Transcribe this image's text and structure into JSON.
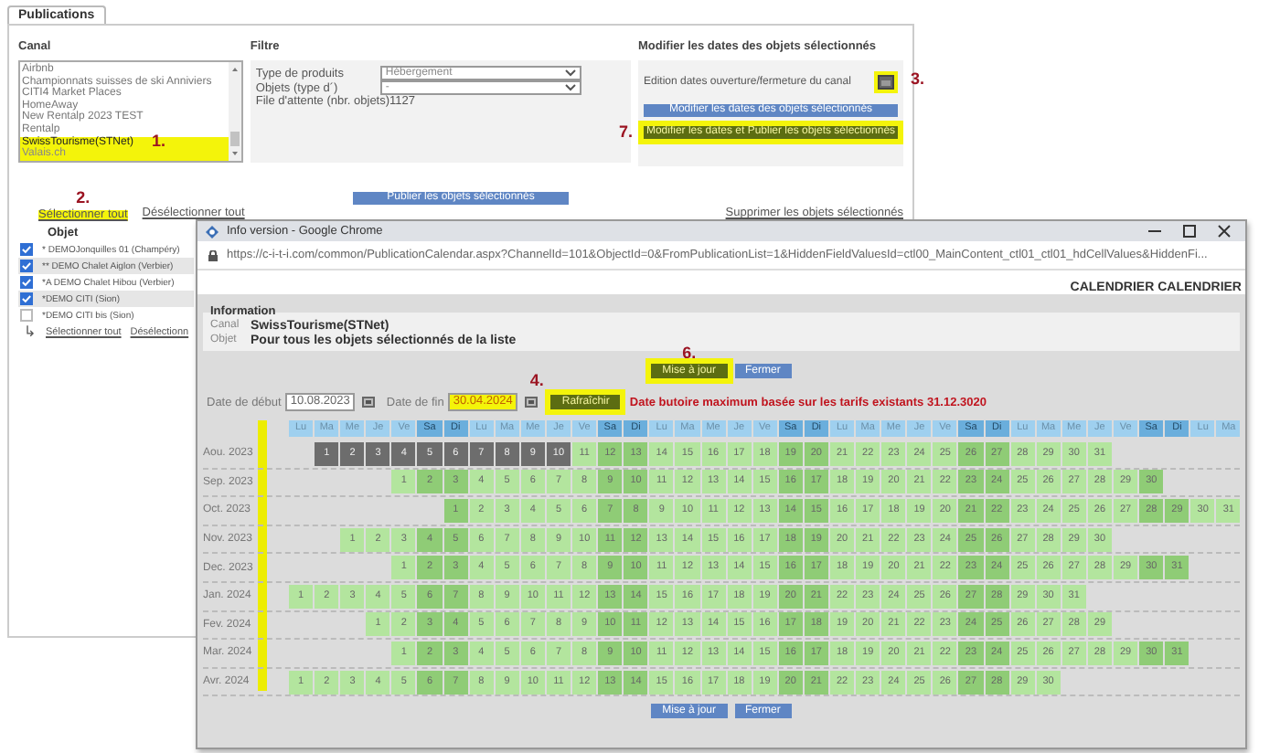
{
  "tabs": [
    {
      "label": "Publications",
      "selected": true
    }
  ],
  "canal": {
    "label": "Canal",
    "items": [
      {
        "label": "Airbnb",
        "selected": false,
        "highlighted": false
      },
      {
        "label": "Championnats suisses de ski Anniviers",
        "selected": false,
        "highlighted": false
      },
      {
        "label": "CITI4 Market Places",
        "selected": false,
        "highlighted": false
      },
      {
        "label": "HomeAway",
        "selected": false,
        "highlighted": false
      },
      {
        "label": "New Rentalp 2023 TEST",
        "selected": false,
        "highlighted": false
      },
      {
        "label": "Rentalp",
        "selected": false,
        "highlighted": false
      },
      {
        "label": "SwissTourisme(STNet)",
        "selected": true,
        "highlighted": true,
        "annotation": "1."
      },
      {
        "label": "Valais.ch",
        "selected": false,
        "highlighted": true
      }
    ]
  },
  "filtre": {
    "label": "Filtre",
    "fields": [
      {
        "label": "Type de produits",
        "value": "Hébergement"
      },
      {
        "label": "Objets (type d´)",
        "value": "-"
      }
    ],
    "queue": "File d'attente (nbr. objets)1127"
  },
  "dates_panel": {
    "title": "Modifier les dates des objets sélectionnés",
    "edit_label": "Edition dates ouverture/fermeture du canal",
    "edit_highlighted": true,
    "edit_annotation": "3.",
    "buttons": [
      {
        "label": "Modifier les dates des objets sélectionnés",
        "highlighted": false
      },
      {
        "label": "Modifier les dates et Publier les objets sélectionnés",
        "highlighted": true,
        "annotation": "7."
      }
    ]
  },
  "publish_button": "Publier les objets sélectionnés",
  "select_links": [
    {
      "label": "Sélectionner tout",
      "highlighted": true,
      "annotation": "2."
    },
    {
      "label": "Désélectionner tout",
      "highlighted": false
    }
  ],
  "delete_link": "Supprimer  les objets sélectionnés",
  "objects": {
    "header": "Objet",
    "rows": [
      {
        "label": "* DEMOJonquilles 01 (Champéry)",
        "checked": true
      },
      {
        "label": "** DEMO Chalet Aiglon (Verbier)",
        "checked": true
      },
      {
        "label": "*A DEMO Chalet Hibou (Verbier)",
        "checked": true
      },
      {
        "label": "*DEMO CITI (Sion)",
        "checked": true
      },
      {
        "label": "*DEMO CITI bis (Sion)",
        "checked": false
      }
    ],
    "sub_arrow": "↳",
    "links": [
      "Sélectionner tout",
      "Désélectionn"
    ]
  },
  "popup": {
    "title": "Info version - Google Chrome",
    "url": "https://c-i-t-i.com/common/PublicationCalendar.aspx?ChannelId=101&ObjectId=0&FromPublicationList=1&HiddenFieldValuesId=ctl00_MainContent_ctl01_ctl01_hdCellValues&HiddenFi...",
    "heading": "CALENDRIER CALENDRIER",
    "info": {
      "title": "Information",
      "rows": [
        {
          "label": "Canal",
          "value": "SwissTourisme(STNet)"
        },
        {
          "label": "Objet",
          "value": "Pour tous les objets sélectionnés de la liste"
        }
      ]
    },
    "top_buttons": [
      {
        "label": "Mise à jour",
        "highlighted": true,
        "annotation": "6."
      },
      {
        "label": "Fermer",
        "highlighted": false
      }
    ],
    "start": {
      "label": "Date de début",
      "value": "10.08.2023",
      "highlighted": false
    },
    "end": {
      "label": "Date de fin",
      "value": "30.04.2024",
      "highlighted": true,
      "annotation": "4."
    },
    "refresh": {
      "label": "Rafraîchir",
      "highlighted": true
    },
    "notice": "Date butoire maximum basée sur les tarifs existants  31.12.3020",
    "month_column_highlighted": true,
    "weekdays": [
      {
        "label": "Lu",
        "weekend": false
      },
      {
        "label": "Ma",
        "weekend": false
      },
      {
        "label": "Me",
        "weekend": false
      },
      {
        "label": "Je",
        "weekend": false
      },
      {
        "label": "Ve",
        "weekend": false
      },
      {
        "label": "Sa",
        "weekend": true
      },
      {
        "label": "Di",
        "weekend": true
      },
      {
        "label": "Lu",
        "weekend": false
      },
      {
        "label": "Ma",
        "weekend": false
      },
      {
        "label": "Me",
        "weekend": false
      },
      {
        "label": "Je",
        "weekend": false
      },
      {
        "label": "Ve",
        "weekend": false
      },
      {
        "label": "Sa",
        "weekend": true
      },
      {
        "label": "Di",
        "weekend": true
      },
      {
        "label": "Lu",
        "weekend": false
      },
      {
        "label": "Ma",
        "weekend": false
      },
      {
        "label": "Me",
        "weekend": false
      },
      {
        "label": "Je",
        "weekend": false
      },
      {
        "label": "Ve",
        "weekend": false
      },
      {
        "label": "Sa",
        "weekend": true
      },
      {
        "label": "Di",
        "weekend": true
      },
      {
        "label": "Lu",
        "weekend": false
      },
      {
        "label": "Ma",
        "weekend": false
      },
      {
        "label": "Me",
        "weekend": false
      },
      {
        "label": "Je",
        "weekend": false
      },
      {
        "label": "Ve",
        "weekend": false
      },
      {
        "label": "Sa",
        "weekend": true
      },
      {
        "label": "Di",
        "weekend": true
      },
      {
        "label": "Lu",
        "weekend": false
      },
      {
        "label": "Ma",
        "weekend": false
      },
      {
        "label": "Me",
        "weekend": false
      },
      {
        "label": "Je",
        "weekend": false
      },
      {
        "label": "Ve",
        "weekend": false
      },
      {
        "label": "Sa",
        "weekend": true
      },
      {
        "label": "Di",
        "weekend": true
      },
      {
        "label": "Lu",
        "weekend": false
      },
      {
        "label": "Ma",
        "weekend": false
      }
    ],
    "months": [
      {
        "label": "Aou. 2023",
        "days": [
          {
            "kind": "blank"
          },
          {
            "kind": "day",
            "d": "1",
            "closed": true
          },
          {
            "kind": "day",
            "d": "2",
            "closed": true
          },
          {
            "kind": "day",
            "d": "3",
            "closed": true
          },
          {
            "kind": "day",
            "d": "4",
            "closed": true
          },
          {
            "kind": "day",
            "d": "5",
            "closed": true
          },
          {
            "kind": "day",
            "d": "6",
            "closed": true
          },
          {
            "kind": "day",
            "d": "7",
            "closed": true
          },
          {
            "kind": "day",
            "d": "8",
            "closed": true
          },
          {
            "kind": "day",
            "d": "9",
            "closed": true
          },
          {
            "kind": "day",
            "d": "10",
            "closed": true
          },
          {
            "kind": "day",
            "d": "11",
            "closed": false
          },
          {
            "kind": "day",
            "d": "12",
            "closed": false
          },
          {
            "kind": "day",
            "d": "13",
            "closed": false
          },
          {
            "kind": "day",
            "d": "14",
            "closed": false
          },
          {
            "kind": "day",
            "d": "15",
            "closed": false
          },
          {
            "kind": "day",
            "d": "16",
            "closed": false
          },
          {
            "kind": "day",
            "d": "17",
            "closed": false
          },
          {
            "kind": "day",
            "d": "18",
            "closed": false
          },
          {
            "kind": "day",
            "d": "19",
            "closed": false
          },
          {
            "kind": "day",
            "d": "20",
            "closed": false
          },
          {
            "kind": "day",
            "d": "21",
            "closed": false
          },
          {
            "kind": "day",
            "d": "22",
            "closed": false
          },
          {
            "kind": "day",
            "d": "23",
            "closed": false
          },
          {
            "kind": "day",
            "d": "24",
            "closed": false
          },
          {
            "kind": "day",
            "d": "25",
            "closed": false
          },
          {
            "kind": "day",
            "d": "26",
            "closed": false
          },
          {
            "kind": "day",
            "d": "27",
            "closed": false
          },
          {
            "kind": "day",
            "d": "28",
            "closed": false
          },
          {
            "kind": "day",
            "d": "29",
            "closed": false
          },
          {
            "kind": "day",
            "d": "30",
            "closed": false
          },
          {
            "kind": "day",
            "d": "31",
            "closed": false
          }
        ]
      },
      {
        "label": "Sep. 2023",
        "days": [
          {
            "kind": "blank"
          },
          {
            "kind": "blank"
          },
          {
            "kind": "blank"
          },
          {
            "kind": "blank"
          },
          {
            "kind": "day",
            "d": "1",
            "closed": false
          },
          {
            "kind": "day",
            "d": "2",
            "closed": false
          },
          {
            "kind": "day",
            "d": "3",
            "closed": false
          },
          {
            "kind": "day",
            "d": "4",
            "closed": false
          },
          {
            "kind": "day",
            "d": "5",
            "closed": false
          },
          {
            "kind": "day",
            "d": "6",
            "closed": false
          },
          {
            "kind": "day",
            "d": "7",
            "closed": false
          },
          {
            "kind": "day",
            "d": "8",
            "closed": false
          },
          {
            "kind": "day",
            "d": "9",
            "closed": false
          },
          {
            "kind": "day",
            "d": "10",
            "closed": false
          },
          {
            "kind": "day",
            "d": "11",
            "closed": false
          },
          {
            "kind": "day",
            "d": "12",
            "closed": false
          },
          {
            "kind": "day",
            "d": "13",
            "closed": false
          },
          {
            "kind": "day",
            "d": "14",
            "closed": false
          },
          {
            "kind": "day",
            "d": "15",
            "closed": false
          },
          {
            "kind": "day",
            "d": "16",
            "closed": false
          },
          {
            "kind": "day",
            "d": "17",
            "closed": false
          },
          {
            "kind": "day",
            "d": "18",
            "closed": false
          },
          {
            "kind": "day",
            "d": "19",
            "closed": false
          },
          {
            "kind": "day",
            "d": "20",
            "closed": false
          },
          {
            "kind": "day",
            "d": "21",
            "closed": false
          },
          {
            "kind": "day",
            "d": "22",
            "closed": false
          },
          {
            "kind": "day",
            "d": "23",
            "closed": false
          },
          {
            "kind": "day",
            "d": "24",
            "closed": false
          },
          {
            "kind": "day",
            "d": "25",
            "closed": false
          },
          {
            "kind": "day",
            "d": "26",
            "closed": false
          },
          {
            "kind": "day",
            "d": "27",
            "closed": false
          },
          {
            "kind": "day",
            "d": "28",
            "closed": false
          },
          {
            "kind": "day",
            "d": "29",
            "closed": false
          },
          {
            "kind": "day",
            "d": "30",
            "closed": false
          }
        ]
      },
      {
        "label": "Oct. 2023",
        "days": [
          {
            "kind": "blank"
          },
          {
            "kind": "blank"
          },
          {
            "kind": "blank"
          },
          {
            "kind": "blank"
          },
          {
            "kind": "blank"
          },
          {
            "kind": "blank"
          },
          {
            "kind": "day",
            "d": "1",
            "closed": false
          },
          {
            "kind": "day",
            "d": "2",
            "closed": false
          },
          {
            "kind": "day",
            "d": "3",
            "closed": false
          },
          {
            "kind": "day",
            "d": "4",
            "closed": false
          },
          {
            "kind": "day",
            "d": "5",
            "closed": false
          },
          {
            "kind": "day",
            "d": "6",
            "closed": false
          },
          {
            "kind": "day",
            "d": "7",
            "closed": false
          },
          {
            "kind": "day",
            "d": "8",
            "closed": false
          },
          {
            "kind": "day",
            "d": "9",
            "closed": false
          },
          {
            "kind": "day",
            "d": "10",
            "closed": false
          },
          {
            "kind": "day",
            "d": "11",
            "closed": false
          },
          {
            "kind": "day",
            "d": "12",
            "closed": false
          },
          {
            "kind": "day",
            "d": "13",
            "closed": false
          },
          {
            "kind": "day",
            "d": "14",
            "closed": false
          },
          {
            "kind": "day",
            "d": "15",
            "closed": false
          },
          {
            "kind": "day",
            "d": "16",
            "closed": false
          },
          {
            "kind": "day",
            "d": "17",
            "closed": false
          },
          {
            "kind": "day",
            "d": "18",
            "closed": false
          },
          {
            "kind": "day",
            "d": "19",
            "closed": false
          },
          {
            "kind": "day",
            "d": "20",
            "closed": false
          },
          {
            "kind": "day",
            "d": "21",
            "closed": false
          },
          {
            "kind": "day",
            "d": "22",
            "closed": false
          },
          {
            "kind": "day",
            "d": "23",
            "closed": false
          },
          {
            "kind": "day",
            "d": "24",
            "closed": false
          },
          {
            "kind": "day",
            "d": "25",
            "closed": false
          },
          {
            "kind": "day",
            "d": "26",
            "closed": false
          },
          {
            "kind": "day",
            "d": "27",
            "closed": false
          },
          {
            "kind": "day",
            "d": "28",
            "closed": false
          },
          {
            "kind": "day",
            "d": "29",
            "closed": false
          },
          {
            "kind": "day",
            "d": "30",
            "closed": false
          },
          {
            "kind": "day",
            "d": "31",
            "closed": false
          }
        ]
      },
      {
        "label": "Nov. 2023",
        "days": [
          {
            "kind": "blank"
          },
          {
            "kind": "blank"
          },
          {
            "kind": "day",
            "d": "1",
            "closed": false
          },
          {
            "kind": "day",
            "d": "2",
            "closed": false
          },
          {
            "kind": "day",
            "d": "3",
            "closed": false
          },
          {
            "kind": "day",
            "d": "4",
            "closed": false
          },
          {
            "kind": "day",
            "d": "5",
            "closed": false
          },
          {
            "kind": "day",
            "d": "6",
            "closed": false
          },
          {
            "kind": "day",
            "d": "7",
            "closed": false
          },
          {
            "kind": "day",
            "d": "8",
            "closed": false
          },
          {
            "kind": "day",
            "d": "9",
            "closed": false
          },
          {
            "kind": "day",
            "d": "10",
            "closed": false
          },
          {
            "kind": "day",
            "d": "11",
            "closed": false
          },
          {
            "kind": "day",
            "d": "12",
            "closed": false
          },
          {
            "kind": "day",
            "d": "13",
            "closed": false
          },
          {
            "kind": "day",
            "d": "14",
            "closed": false
          },
          {
            "kind": "day",
            "d": "15",
            "closed": false
          },
          {
            "kind": "day",
            "d": "16",
            "closed": false
          },
          {
            "kind": "day",
            "d": "17",
            "closed": false
          },
          {
            "kind": "day",
            "d": "18",
            "closed": false
          },
          {
            "kind": "day",
            "d": "19",
            "closed": false
          },
          {
            "kind": "day",
            "d": "20",
            "closed": false
          },
          {
            "kind": "day",
            "d": "21",
            "closed": false
          },
          {
            "kind": "day",
            "d": "22",
            "closed": false
          },
          {
            "kind": "day",
            "d": "23",
            "closed": false
          },
          {
            "kind": "day",
            "d": "24",
            "closed": false
          },
          {
            "kind": "day",
            "d": "25",
            "closed": false
          },
          {
            "kind": "day",
            "d": "26",
            "closed": false
          },
          {
            "kind": "day",
            "d": "27",
            "closed": false
          },
          {
            "kind": "day",
            "d": "28",
            "closed": false
          },
          {
            "kind": "day",
            "d": "29",
            "closed": false
          },
          {
            "kind": "day",
            "d": "30",
            "closed": false
          }
        ]
      },
      {
        "label": "Dec. 2023",
        "days": [
          {
            "kind": "blank"
          },
          {
            "kind": "blank"
          },
          {
            "kind": "blank"
          },
          {
            "kind": "blank"
          },
          {
            "kind": "day",
            "d": "1",
            "closed": false
          },
          {
            "kind": "day",
            "d": "2",
            "closed": false
          },
          {
            "kind": "day",
            "d": "3",
            "closed": false
          },
          {
            "kind": "day",
            "d": "4",
            "closed": false
          },
          {
            "kind": "day",
            "d": "5",
            "closed": false
          },
          {
            "kind": "day",
            "d": "6",
            "closed": false
          },
          {
            "kind": "day",
            "d": "7",
            "closed": false
          },
          {
            "kind": "day",
            "d": "8",
            "closed": false
          },
          {
            "kind": "day",
            "d": "9",
            "closed": false
          },
          {
            "kind": "day",
            "d": "10",
            "closed": false
          },
          {
            "kind": "day",
            "d": "11",
            "closed": false
          },
          {
            "kind": "day",
            "d": "12",
            "closed": false
          },
          {
            "kind": "day",
            "d": "13",
            "closed": false
          },
          {
            "kind": "day",
            "d": "14",
            "closed": false
          },
          {
            "kind": "day",
            "d": "15",
            "closed": false
          },
          {
            "kind": "day",
            "d": "16",
            "closed": false
          },
          {
            "kind": "day",
            "d": "17",
            "closed": false
          },
          {
            "kind": "day",
            "d": "18",
            "closed": false
          },
          {
            "kind": "day",
            "d": "19",
            "closed": false
          },
          {
            "kind": "day",
            "d": "20",
            "closed": false
          },
          {
            "kind": "day",
            "d": "21",
            "closed": false
          },
          {
            "kind": "day",
            "d": "22",
            "closed": false
          },
          {
            "kind": "day",
            "d": "23",
            "closed": false
          },
          {
            "kind": "day",
            "d": "24",
            "closed": false
          },
          {
            "kind": "day",
            "d": "25",
            "closed": false
          },
          {
            "kind": "day",
            "d": "26",
            "closed": false
          },
          {
            "kind": "day",
            "d": "27",
            "closed": false
          },
          {
            "kind": "day",
            "d": "28",
            "closed": false
          },
          {
            "kind": "day",
            "d": "29",
            "closed": false
          },
          {
            "kind": "day",
            "d": "30",
            "closed": false
          },
          {
            "kind": "day",
            "d": "31",
            "closed": false
          }
        ]
      },
      {
        "label": "Jan. 2024",
        "days": [
          {
            "kind": "day",
            "d": "1",
            "closed": false
          },
          {
            "kind": "day",
            "d": "2",
            "closed": false
          },
          {
            "kind": "day",
            "d": "3",
            "closed": false
          },
          {
            "kind": "day",
            "d": "4",
            "closed": false
          },
          {
            "kind": "day",
            "d": "5",
            "closed": false
          },
          {
            "kind": "day",
            "d": "6",
            "closed": false
          },
          {
            "kind": "day",
            "d": "7",
            "closed": false
          },
          {
            "kind": "day",
            "d": "8",
            "closed": false
          },
          {
            "kind": "day",
            "d": "9",
            "closed": false
          },
          {
            "kind": "day",
            "d": "10",
            "closed": false
          },
          {
            "kind": "day",
            "d": "11",
            "closed": false
          },
          {
            "kind": "day",
            "d": "12",
            "closed": false
          },
          {
            "kind": "day",
            "d": "13",
            "closed": false
          },
          {
            "kind": "day",
            "d": "14",
            "closed": false
          },
          {
            "kind": "day",
            "d": "15",
            "closed": false
          },
          {
            "kind": "day",
            "d": "16",
            "closed": false
          },
          {
            "kind": "day",
            "d": "17",
            "closed": false
          },
          {
            "kind": "day",
            "d": "18",
            "closed": false
          },
          {
            "kind": "day",
            "d": "19",
            "closed": false
          },
          {
            "kind": "day",
            "d": "20",
            "closed": false
          },
          {
            "kind": "day",
            "d": "21",
            "closed": false
          },
          {
            "kind": "day",
            "d": "22",
            "closed": false
          },
          {
            "kind": "day",
            "d": "23",
            "closed": false
          },
          {
            "kind": "day",
            "d": "24",
            "closed": false
          },
          {
            "kind": "day",
            "d": "25",
            "closed": false
          },
          {
            "kind": "day",
            "d": "26",
            "closed": false
          },
          {
            "kind": "day",
            "d": "27",
            "closed": false
          },
          {
            "kind": "day",
            "d": "28",
            "closed": false
          },
          {
            "kind": "day",
            "d": "29",
            "closed": false
          },
          {
            "kind": "day",
            "d": "30",
            "closed": false
          },
          {
            "kind": "day",
            "d": "31",
            "closed": false
          }
        ]
      },
      {
        "label": "Fev. 2024",
        "days": [
          {
            "kind": "blank"
          },
          {
            "kind": "blank"
          },
          {
            "kind": "blank"
          },
          {
            "kind": "day",
            "d": "1",
            "closed": false
          },
          {
            "kind": "day",
            "d": "2",
            "closed": false
          },
          {
            "kind": "day",
            "d": "3",
            "closed": false
          },
          {
            "kind": "day",
            "d": "4",
            "closed": false
          },
          {
            "kind": "day",
            "d": "5",
            "closed": false
          },
          {
            "kind": "day",
            "d": "6",
            "closed": false
          },
          {
            "kind": "day",
            "d": "7",
            "closed": false
          },
          {
            "kind": "day",
            "d": "8",
            "closed": false
          },
          {
            "kind": "day",
            "d": "9",
            "closed": false
          },
          {
            "kind": "day",
            "d": "10",
            "closed": false
          },
          {
            "kind": "day",
            "d": "11",
            "closed": false
          },
          {
            "kind": "day",
            "d": "12",
            "closed": false
          },
          {
            "kind": "day",
            "d": "13",
            "closed": false
          },
          {
            "kind": "day",
            "d": "14",
            "closed": false
          },
          {
            "kind": "day",
            "d": "15",
            "closed": false
          },
          {
            "kind": "day",
            "d": "16",
            "closed": false
          },
          {
            "kind": "day",
            "d": "17",
            "closed": false
          },
          {
            "kind": "day",
            "d": "18",
            "closed": false
          },
          {
            "kind": "day",
            "d": "19",
            "closed": false
          },
          {
            "kind": "day",
            "d": "20",
            "closed": false
          },
          {
            "kind": "day",
            "d": "21",
            "closed": false
          },
          {
            "kind": "day",
            "d": "22",
            "closed": false
          },
          {
            "kind": "day",
            "d": "23",
            "closed": false
          },
          {
            "kind": "day",
            "d": "24",
            "closed": false
          },
          {
            "kind": "day",
            "d": "25",
            "closed": false
          },
          {
            "kind": "day",
            "d": "26",
            "closed": false
          },
          {
            "kind": "day",
            "d": "27",
            "closed": false
          },
          {
            "kind": "day",
            "d": "28",
            "closed": false
          },
          {
            "kind": "day",
            "d": "29",
            "closed": false
          }
        ]
      },
      {
        "label": "Mar. 2024",
        "days": [
          {
            "kind": "blank"
          },
          {
            "kind": "blank"
          },
          {
            "kind": "blank"
          },
          {
            "kind": "blank"
          },
          {
            "kind": "day",
            "d": "1",
            "closed": false
          },
          {
            "kind": "day",
            "d": "2",
            "closed": false
          },
          {
            "kind": "day",
            "d": "3",
            "closed": false
          },
          {
            "kind": "day",
            "d": "4",
            "closed": false
          },
          {
            "kind": "day",
            "d": "5",
            "closed": false
          },
          {
            "kind": "day",
            "d": "6",
            "closed": false
          },
          {
            "kind": "day",
            "d": "7",
            "closed": false
          },
          {
            "kind": "day",
            "d": "8",
            "closed": false
          },
          {
            "kind": "day",
            "d": "9",
            "closed": false
          },
          {
            "kind": "day",
            "d": "10",
            "closed": false
          },
          {
            "kind": "day",
            "d": "11",
            "closed": false
          },
          {
            "kind": "day",
            "d": "12",
            "closed": false
          },
          {
            "kind": "day",
            "d": "13",
            "closed": false
          },
          {
            "kind": "day",
            "d": "14",
            "closed": false
          },
          {
            "kind": "day",
            "d": "15",
            "closed": false
          },
          {
            "kind": "day",
            "d": "16",
            "closed": false
          },
          {
            "kind": "day",
            "d": "17",
            "closed": false
          },
          {
            "kind": "day",
            "d": "18",
            "closed": false
          },
          {
            "kind": "day",
            "d": "19",
            "closed": false
          },
          {
            "kind": "day",
            "d": "20",
            "closed": false
          },
          {
            "kind": "day",
            "d": "21",
            "closed": false
          },
          {
            "kind": "day",
            "d": "22",
            "closed": false
          },
          {
            "kind": "day",
            "d": "23",
            "closed": false
          },
          {
            "kind": "day",
            "d": "24",
            "closed": false
          },
          {
            "kind": "day",
            "d": "25",
            "closed": false
          },
          {
            "kind": "day",
            "d": "26",
            "closed": false
          },
          {
            "kind": "day",
            "d": "27",
            "closed": false
          },
          {
            "kind": "day",
            "d": "28",
            "closed": false
          },
          {
            "kind": "day",
            "d": "29",
            "closed": false
          },
          {
            "kind": "day",
            "d": "30",
            "closed": false
          },
          {
            "kind": "day",
            "d": "31",
            "closed": false
          }
        ]
      },
      {
        "label": "Avr. 2024",
        "days": [
          {
            "kind": "day",
            "d": "1",
            "closed": false
          },
          {
            "kind": "day",
            "d": "2",
            "closed": false
          },
          {
            "kind": "day",
            "d": "3",
            "closed": false
          },
          {
            "kind": "day",
            "d": "4",
            "closed": false
          },
          {
            "kind": "day",
            "d": "5",
            "closed": false
          },
          {
            "kind": "day",
            "d": "6",
            "closed": false
          },
          {
            "kind": "day",
            "d": "7",
            "closed": false
          },
          {
            "kind": "day",
            "d": "8",
            "closed": false
          },
          {
            "kind": "day",
            "d": "9",
            "closed": false
          },
          {
            "kind": "day",
            "d": "10",
            "closed": false
          },
          {
            "kind": "day",
            "d": "11",
            "closed": false
          },
          {
            "kind": "day",
            "d": "12",
            "closed": false
          },
          {
            "kind": "day",
            "d": "13",
            "closed": false
          },
          {
            "kind": "day",
            "d": "14",
            "closed": false
          },
          {
            "kind": "day",
            "d": "15",
            "closed": false
          },
          {
            "kind": "day",
            "d": "16",
            "closed": false
          },
          {
            "kind": "day",
            "d": "17",
            "closed": false
          },
          {
            "kind": "day",
            "d": "18",
            "closed": false
          },
          {
            "kind": "day",
            "d": "19",
            "closed": false
          },
          {
            "kind": "day",
            "d": "20",
            "closed": false
          },
          {
            "kind": "day",
            "d": "21",
            "closed": false
          },
          {
            "kind": "day",
            "d": "22",
            "closed": false
          },
          {
            "kind": "day",
            "d": "23",
            "closed": false
          },
          {
            "kind": "day",
            "d": "24",
            "closed": false
          },
          {
            "kind": "day",
            "d": "25",
            "closed": false
          },
          {
            "kind": "day",
            "d": "26",
            "closed": false
          },
          {
            "kind": "day",
            "d": "27",
            "closed": false
          },
          {
            "kind": "day",
            "d": "28",
            "closed": false
          },
          {
            "kind": "day",
            "d": "29",
            "closed": false
          },
          {
            "kind": "day",
            "d": "30",
            "closed": false
          }
        ]
      }
    ],
    "bottom_buttons": [
      {
        "label": "Mise à jour",
        "highlighted": false
      },
      {
        "label": "Fermer",
        "highlighted": false
      }
    ]
  }
}
